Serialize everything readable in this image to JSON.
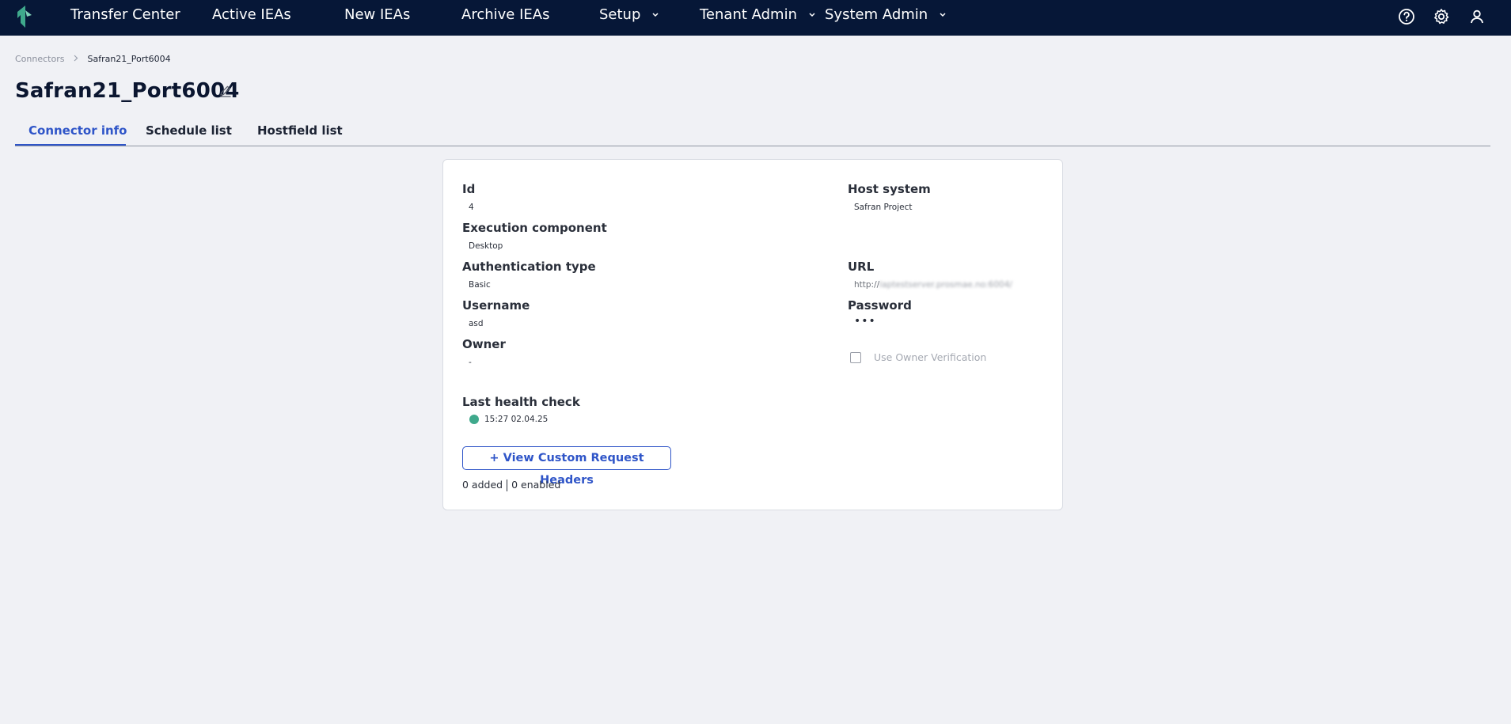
{
  "nav": {
    "items": [
      {
        "label": "Transfer Center",
        "dropdown": false
      },
      {
        "label": "Active IEAs",
        "dropdown": false
      },
      {
        "label": "New IEAs",
        "dropdown": false
      },
      {
        "label": "Archive IEAs",
        "dropdown": false
      },
      {
        "label": "Setup",
        "dropdown": true
      },
      {
        "label": "Tenant Admin",
        "dropdown": true
      },
      {
        "label": "System Admin",
        "dropdown": true
      }
    ],
    "icons": [
      "help-icon",
      "gear-icon",
      "user-icon"
    ]
  },
  "breadcrumb": {
    "parent": "Connectors",
    "current": "Safran21_Port6004"
  },
  "page": {
    "title": "Safran21_Port6004"
  },
  "tabs": [
    {
      "label": "Connector info",
      "active": true
    },
    {
      "label": "Schedule list",
      "active": false
    },
    {
      "label": "Hostfield list",
      "active": false
    }
  ],
  "connector": {
    "id": {
      "label": "Id",
      "value": "4"
    },
    "execution_component": {
      "label": "Execution component",
      "value": "Desktop"
    },
    "authentication_type": {
      "label": "Authentication type",
      "value": "Basic"
    },
    "username": {
      "label": "Username",
      "value": "asd"
    },
    "owner": {
      "label": "Owner",
      "value": "-"
    },
    "host_system": {
      "label": "Host system",
      "value": "Safran Project"
    },
    "url": {
      "label": "URL",
      "value_prefix": "http://",
      "value_redacted": "laptestserver.prosmae.no:6004/"
    },
    "password": {
      "label": "Password",
      "value": "•••"
    },
    "owner_verification": {
      "label": "Use Owner Verification",
      "checked": false
    },
    "last_health_check": {
      "label": "Last health check",
      "value": "15:27 02.04.25",
      "status_color": "#3fa98c"
    }
  },
  "custom_headers": {
    "button_label": "View Custom Request Headers",
    "button_prefix": "+",
    "added": "0 added",
    "enabled": "0 enabled"
  },
  "colors": {
    "topbar": "#061737",
    "accent": "#2f55c8",
    "background": "#f0f1f5",
    "health_ok": "#3fa98c"
  }
}
